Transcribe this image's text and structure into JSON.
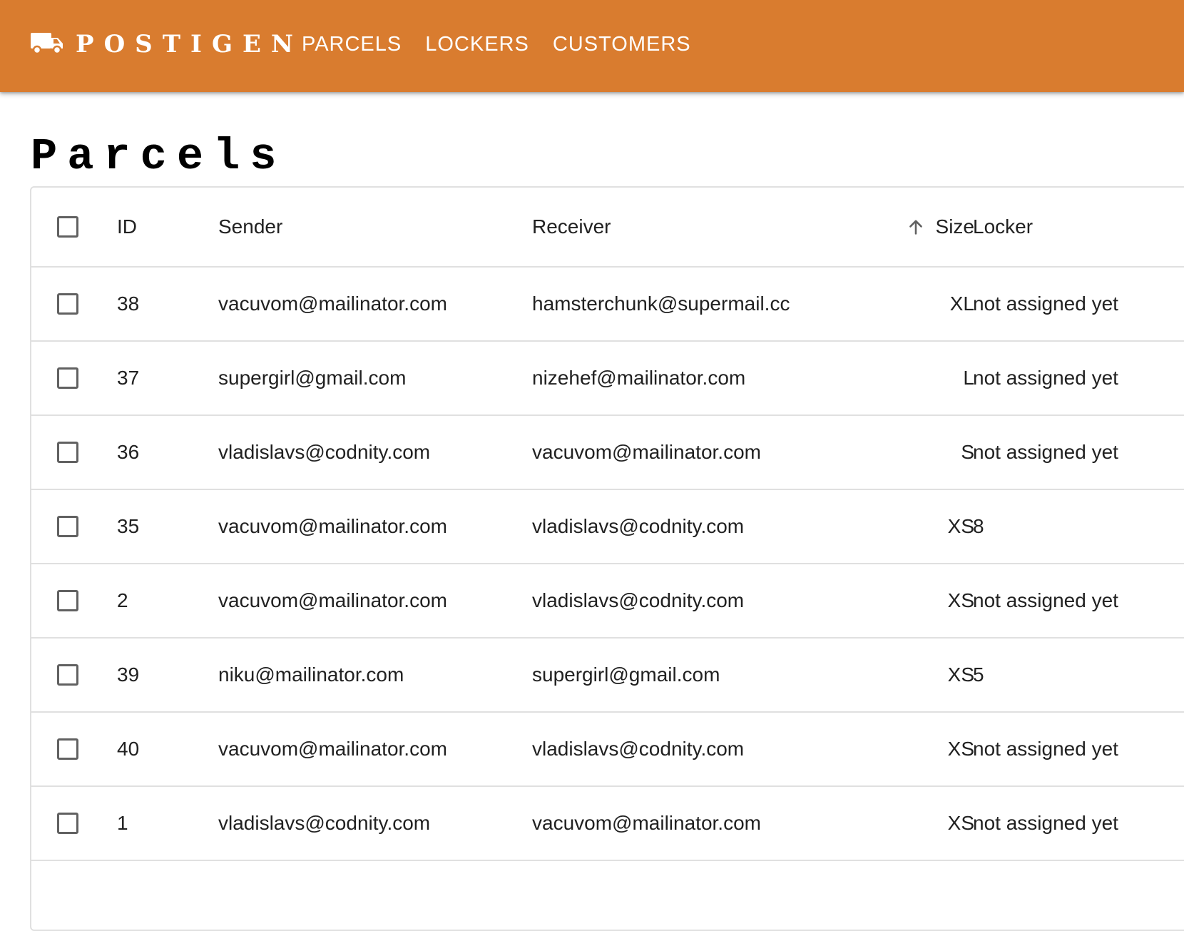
{
  "brand": "POSTIGEN",
  "brand_color": "#D97C2F",
  "logo_icon": "truck-icon",
  "nav": {
    "parcels": "PARCELS",
    "lockers": "LOCKERS",
    "customers": "CUSTOMERS"
  },
  "page_title": "Parcels",
  "table": {
    "sort_icon": "arrow-up-icon",
    "sorted_column": "Size",
    "sort_direction": "ascending",
    "columns": {
      "id": "ID",
      "sender": "Sender",
      "receiver": "Receiver",
      "size": "Size",
      "locker": "Locker"
    },
    "rows": [
      {
        "id": "38",
        "sender": "vacuvom@mailinator.com",
        "receiver": "hamsterchunk@supermail.cc",
        "size": "XL",
        "locker": "not assigned yet"
      },
      {
        "id": "37",
        "sender": "supergirl@gmail.com",
        "receiver": "nizehef@mailinator.com",
        "size": "L",
        "locker": "not assigned yet"
      },
      {
        "id": "36",
        "sender": "vladislavs@codnity.com",
        "receiver": "vacuvom@mailinator.com",
        "size": "S",
        "locker": "not assigned yet"
      },
      {
        "id": "35",
        "sender": "vacuvom@mailinator.com",
        "receiver": "vladislavs@codnity.com",
        "size": "XS",
        "locker": "8"
      },
      {
        "id": "2",
        "sender": "vacuvom@mailinator.com",
        "receiver": "vladislavs@codnity.com",
        "size": "XS",
        "locker": "not assigned yet"
      },
      {
        "id": "39",
        "sender": "niku@mailinator.com",
        "receiver": "supergirl@gmail.com",
        "size": "XS",
        "locker": "5"
      },
      {
        "id": "40",
        "sender": "vacuvom@mailinator.com",
        "receiver": "vladislavs@codnity.com",
        "size": "XS",
        "locker": "not assigned yet"
      },
      {
        "id": "1",
        "sender": "vladislavs@codnity.com",
        "receiver": "vacuvom@mailinator.com",
        "size": "XS",
        "locker": "not assigned yet"
      }
    ]
  }
}
